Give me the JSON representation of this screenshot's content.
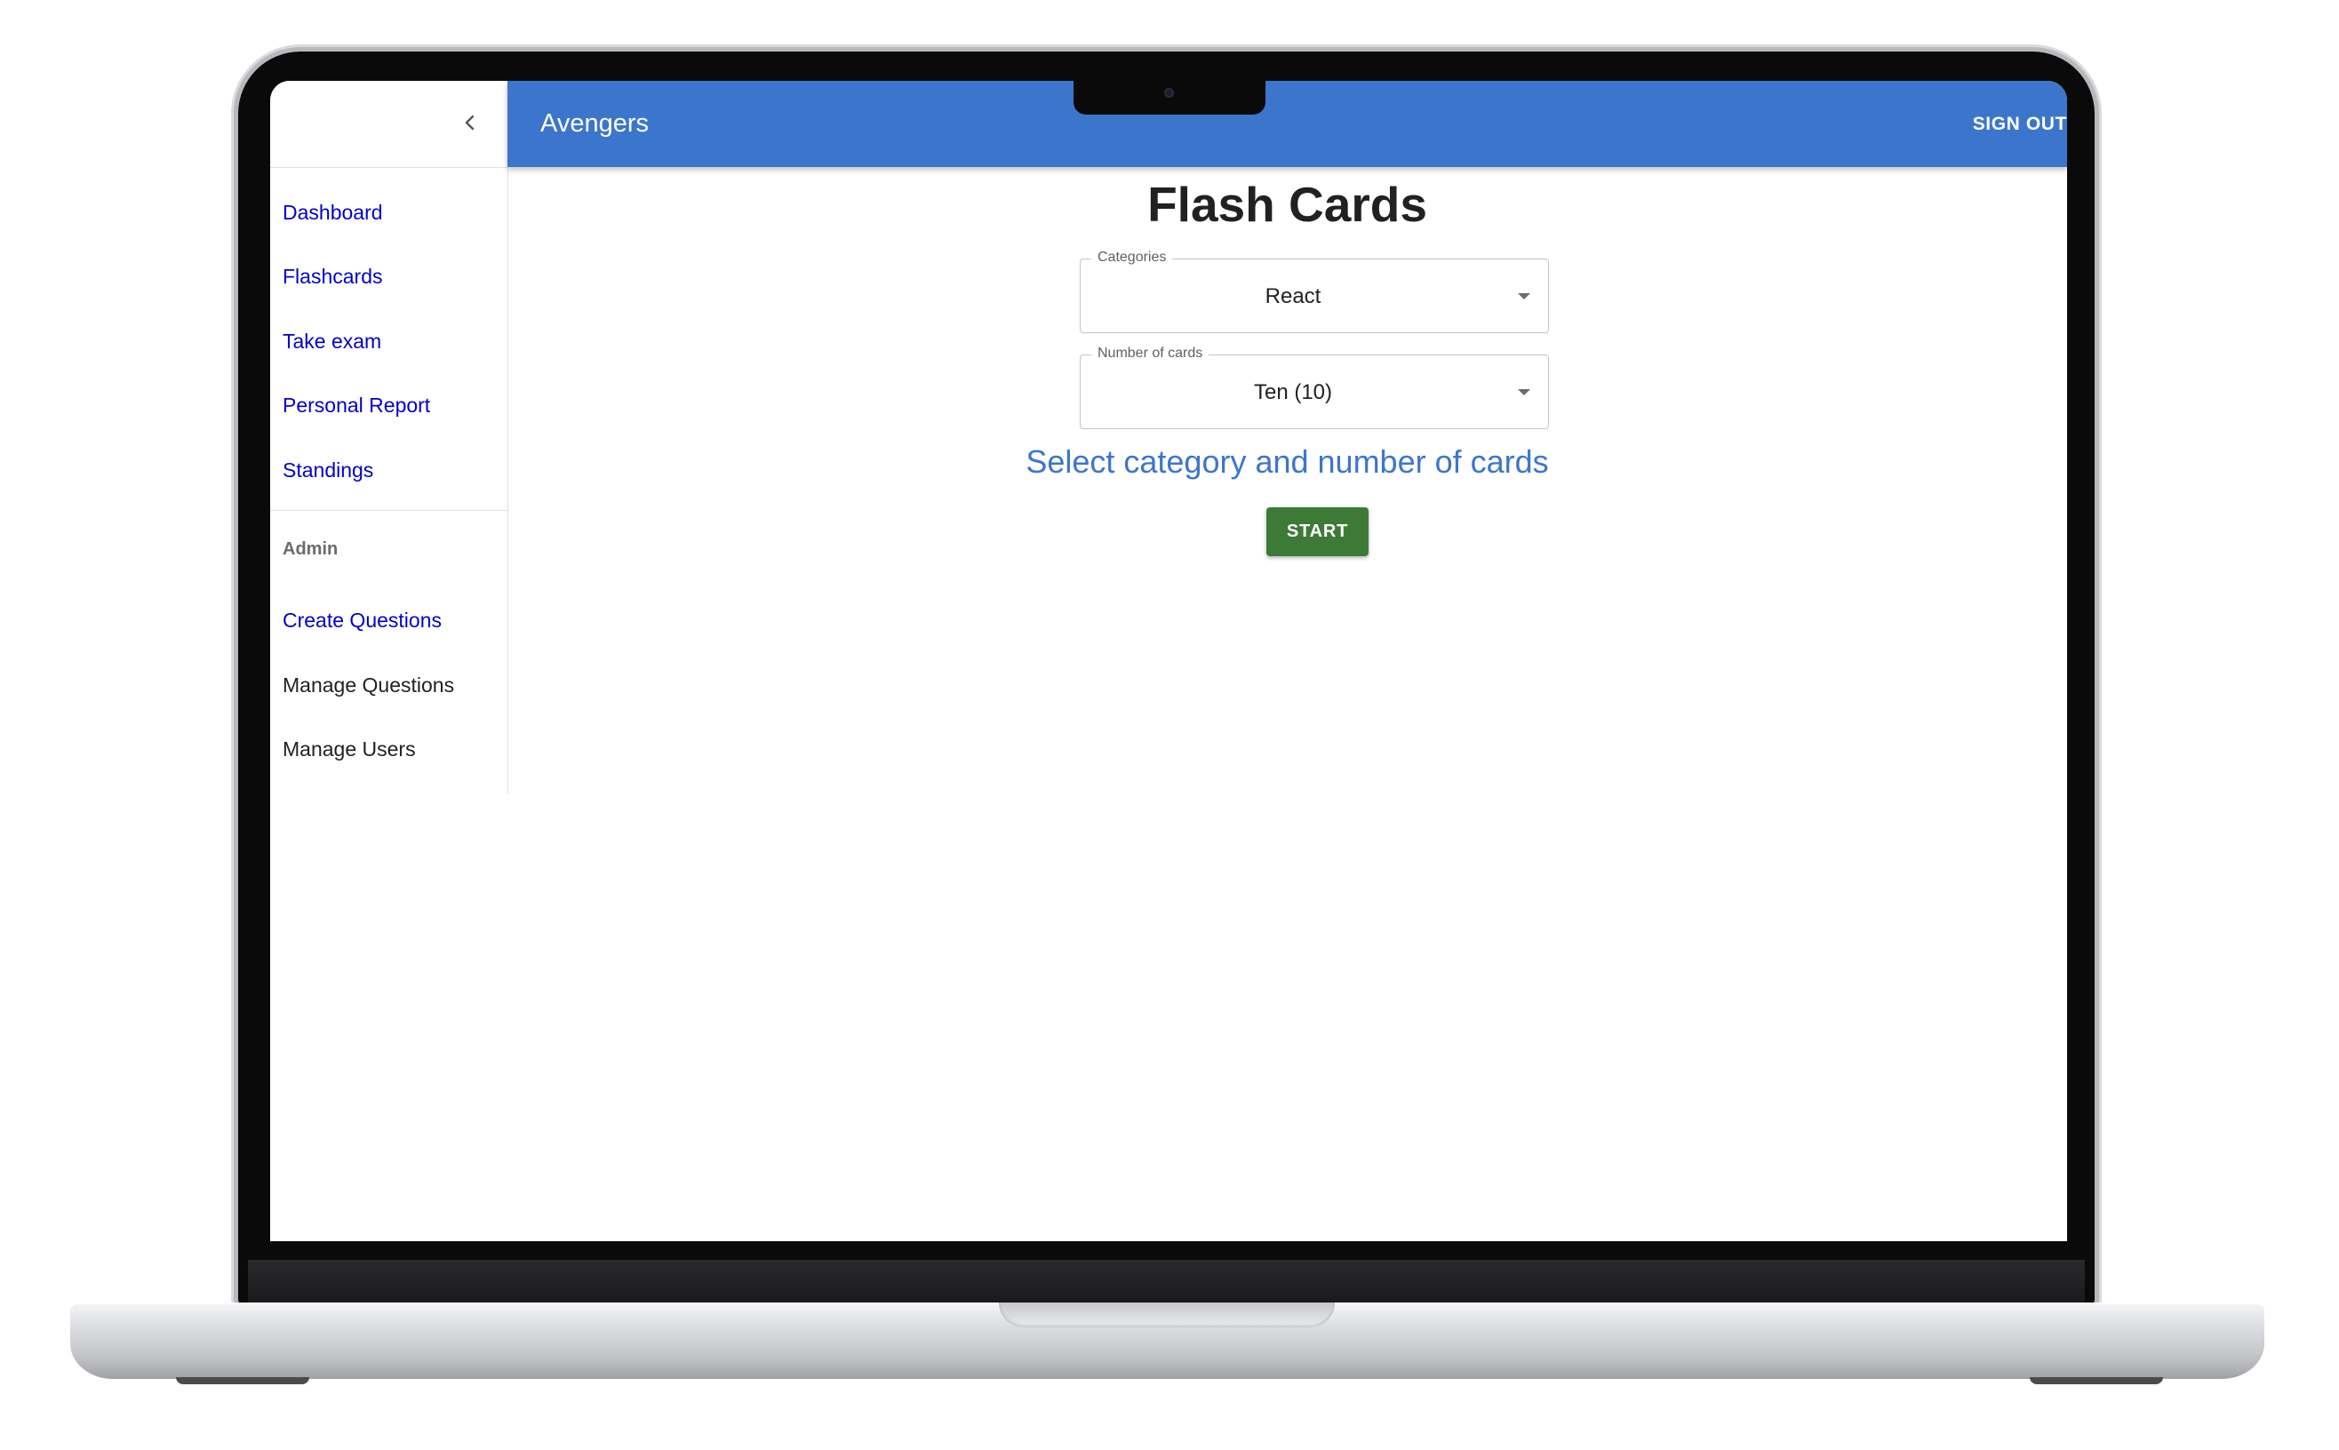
{
  "app": {
    "title": "Avengers",
    "sign_out_label": "SIGN OUT"
  },
  "drawer": {
    "collapse_icon": "chevron-left-icon",
    "nav_items": [
      {
        "label": "Dashboard"
      },
      {
        "label": "Flashcards"
      },
      {
        "label": "Take exam"
      },
      {
        "label": "Personal Report"
      },
      {
        "label": "Standings"
      }
    ],
    "admin": {
      "subheader": "Admin",
      "items": [
        {
          "label": "Create Questions"
        },
        {
          "label": "Manage Questions"
        },
        {
          "label": "Manage Users"
        }
      ]
    }
  },
  "main": {
    "title": "Flash Cards",
    "categories": {
      "label": "Categories",
      "value": "React"
    },
    "number_of_cards": {
      "label": "Number of cards",
      "value": "Ten (10)"
    },
    "helper_text": "Select category and number of cards",
    "start_label": "START"
  },
  "colors": {
    "appbar": "#3b76cc",
    "nav_link": "#0000cc",
    "start_button": "#3d7a38",
    "helper_text": "#3b76cc"
  }
}
